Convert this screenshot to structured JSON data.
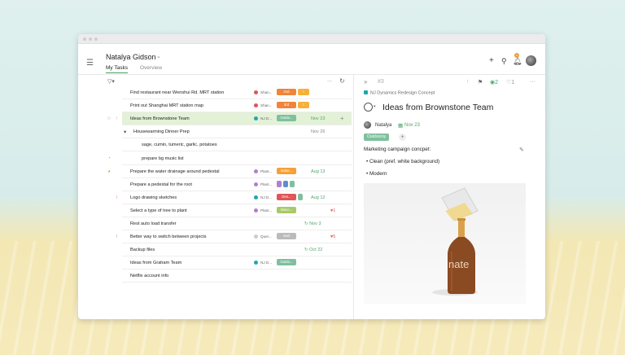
{
  "colors": {
    "accent": "#3ba35c",
    "selected_row": "#e3f1d7",
    "date_green": "#4ea56c"
  },
  "header": {
    "user_name": "Natalya Gidson",
    "tabs": [
      {
        "label": "My Tasks",
        "active": true
      },
      {
        "label": "Overview",
        "active": false
      }
    ],
    "icons": [
      "menu-icon",
      "chevron-down-icon",
      "plus-icon",
      "search-icon",
      "bell-icon",
      "avatar"
    ],
    "bell_count": "1"
  },
  "task_list": {
    "toolbar": {
      "filter_icon": "filter-icon",
      "more": "...",
      "refresh_icon": "refresh-icon"
    },
    "rows": [
      {
        "title": "Find restaurant near Wenshui Rd. MRT station",
        "project": "Shan...",
        "project_color": "#e05555",
        "tags": [
          {
            "text": "2nd",
            "color": "#f0843a"
          },
          {
            "text": "!",
            "color": "#f5b03a"
          }
        ]
      },
      {
        "title": "Print out Shanghai MRT station map",
        "project": "Shan...",
        "project_color": "#e05555",
        "tags": [
          {
            "text": "3rd",
            "color": "#f0843a"
          },
          {
            "text": "!",
            "color": "#f5b03a"
          }
        ]
      },
      {
        "title": "Ideas from Brownstone Team",
        "project": "NJ D...",
        "project_color": "#1aa8b0",
        "tags": [
          {
            "text": "Outdo...",
            "color": "#7fbf9e"
          }
        ],
        "date": "Nov 23",
        "selected": true
      },
      {
        "title": "Housewarming Dinner Prep",
        "date": "Nov 26",
        "date_grey": true
      },
      {
        "title": "sage, cumin, tumeric, garlic, potatoes"
      },
      {
        "title": "prepare bg music list"
      },
      {
        "title": "Prepare the water drainage around pedestal",
        "project": "Plant...",
        "project_color": "#b07fd0",
        "tags": [
          {
            "text": "indoo...",
            "color": "#f5a03a"
          }
        ],
        "date": "Aug 13"
      },
      {
        "title": "Prepare a pedestal for the root",
        "project": "Plant...",
        "project_color": "#b07fd0",
        "tags": [
          {
            "text": "",
            "color": "#b07fd0"
          },
          {
            "text": "",
            "color": "#5b8fd0"
          },
          {
            "text": "",
            "color": "#7fbf9e"
          }
        ]
      },
      {
        "title": "Logo drawing sketches",
        "project": "NJ D...",
        "project_color": "#1aa8b0",
        "tags": [
          {
            "text": "Des...",
            "color": "#e05555"
          },
          {
            "text": "",
            "color": "#7fbf9e"
          }
        ],
        "date": "Aug 12"
      },
      {
        "title": "Select a type of tree to plant",
        "project": "Plant...",
        "project_color": "#b07fd0",
        "tags": [
          {
            "text": "Disco...",
            "color": "#a8c96a"
          }
        ],
        "heart": "1"
      },
      {
        "title": "Rest auto load transfer",
        "date": "Nov 3",
        "repeat": true
      },
      {
        "title": "Better way to switch between projects",
        "project": "Quer...",
        "project_color": "#cccccc",
        "tags": [
          {
            "text": "mart",
            "color": "#bbbbbb"
          }
        ],
        "heart": "5"
      },
      {
        "title": "Backup files",
        "date": "Oct 22",
        "repeat": true
      },
      {
        "title": "Ideas from Graham Team",
        "project": "NJ D...",
        "project_color": "#1aa8b0",
        "tags": [
          {
            "text": "Outdo...",
            "color": "#7fbf9e"
          }
        ]
      },
      {
        "title": "Netflix account info"
      }
    ]
  },
  "detail": {
    "task_number": "#3",
    "project": "NJ Dynamics Redesign Concept",
    "title": "Ideas from Brownstone Team",
    "assignee": "Natalya",
    "date": "Nov 23",
    "tag": "Outdoorsy",
    "description": "Marketing campaign concpet:",
    "bullets": [
      "Clean (pref. white background)",
      "Modern"
    ],
    "watchers": "2",
    "likes": "1",
    "bottle_label": "nate"
  }
}
